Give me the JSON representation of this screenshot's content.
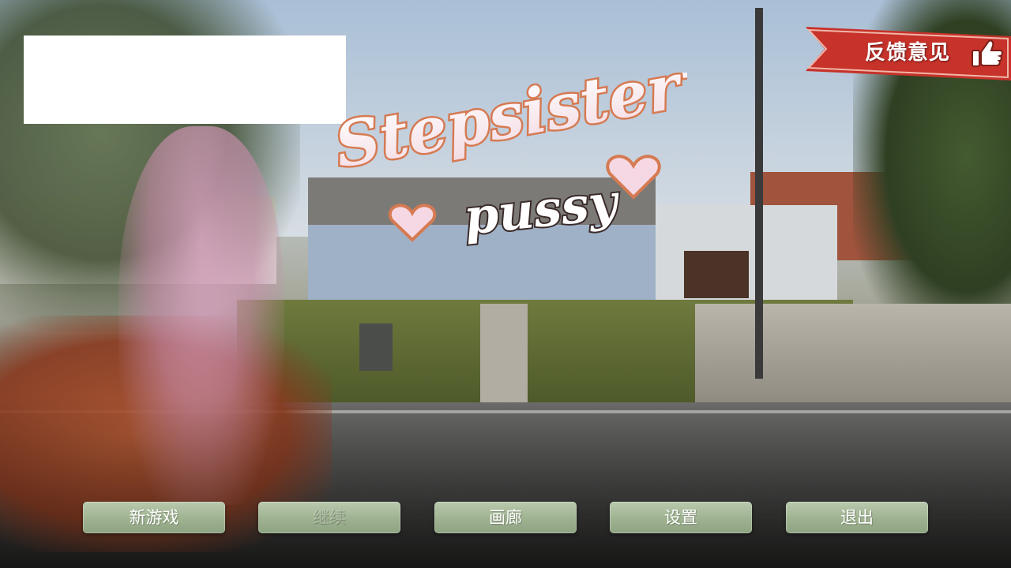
{
  "title_logo": {
    "line1": "Stepsister's",
    "line2": "pussy"
  },
  "feedback": {
    "label": "反馈意见",
    "icon": "thumbs-up-icon",
    "ribbon_color": "#c7322a"
  },
  "menu": {
    "items": [
      {
        "label": "新游戏",
        "enabled": true
      },
      {
        "label": "继续",
        "enabled": false
      },
      {
        "label": "画廊",
        "enabled": true
      },
      {
        "label": "设置",
        "enabled": true
      },
      {
        "label": "退出",
        "enabled": true
      }
    ],
    "button_color": "#a9bb9c"
  }
}
